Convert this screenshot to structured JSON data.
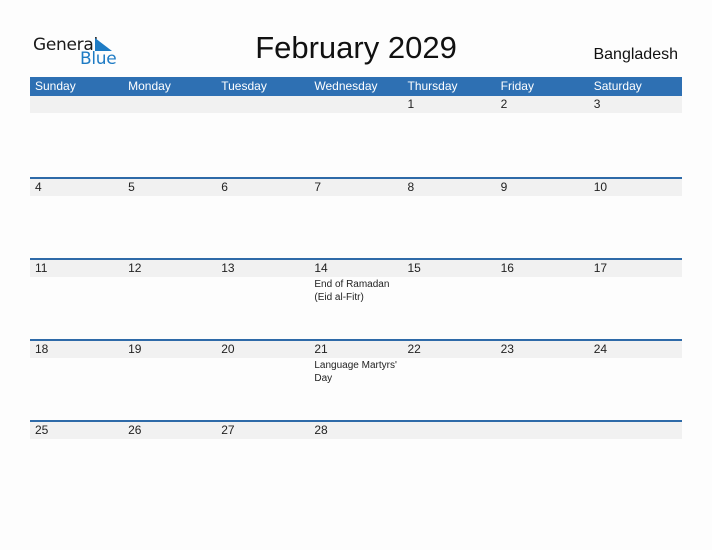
{
  "logo": {
    "word1": "General",
    "word2": "Blue",
    "accent_color": "#1e7bc4"
  },
  "header": {
    "title": "February 2029",
    "country": "Bangladesh"
  },
  "colors": {
    "header_bar": "#2e70b3",
    "week_line": "#2e6aa8",
    "date_band": "#f1f1f1"
  },
  "weekdays": [
    "Sunday",
    "Monday",
    "Tuesday",
    "Wednesday",
    "Thursday",
    "Friday",
    "Saturday"
  ],
  "weeks": [
    [
      {
        "day": ""
      },
      {
        "day": ""
      },
      {
        "day": ""
      },
      {
        "day": ""
      },
      {
        "day": "1"
      },
      {
        "day": "2"
      },
      {
        "day": "3"
      }
    ],
    [
      {
        "day": "4"
      },
      {
        "day": "5"
      },
      {
        "day": "6"
      },
      {
        "day": "7"
      },
      {
        "day": "8"
      },
      {
        "day": "9"
      },
      {
        "day": "10"
      }
    ],
    [
      {
        "day": "11"
      },
      {
        "day": "12"
      },
      {
        "day": "13"
      },
      {
        "day": "14",
        "event": "End of Ramadan (Eid al-Fitr)"
      },
      {
        "day": "15"
      },
      {
        "day": "16"
      },
      {
        "day": "17"
      }
    ],
    [
      {
        "day": "18"
      },
      {
        "day": "19"
      },
      {
        "day": "20"
      },
      {
        "day": "21",
        "event": "Language Martyrs' Day"
      },
      {
        "day": "22"
      },
      {
        "day": "23"
      },
      {
        "day": "24"
      }
    ],
    [
      {
        "day": "25"
      },
      {
        "day": "26"
      },
      {
        "day": "27"
      },
      {
        "day": "28"
      },
      {
        "day": ""
      },
      {
        "day": ""
      },
      {
        "day": ""
      }
    ]
  ]
}
